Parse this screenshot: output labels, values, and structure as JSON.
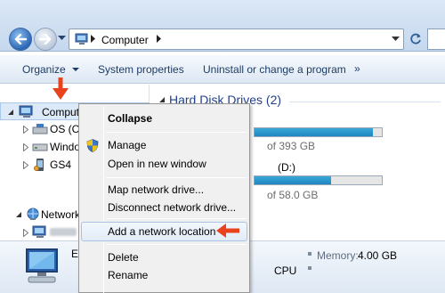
{
  "address": {
    "location": "Computer"
  },
  "commands": {
    "organize": "Organize",
    "system_properties": "System properties",
    "uninstall": "Uninstall or change a program",
    "more": "»"
  },
  "tree": {
    "computer": "Computer",
    "os": "OS (C:",
    "windows": "Windo",
    "gs4": "GS4",
    "network": "Network"
  },
  "main": {
    "group_title": "Hard Disk Drives (2)",
    "drive1_detail": "of 393 GB",
    "drive1_fill_percent": 93,
    "drive2_name": "(D:)",
    "drive2_detail": "of 58.0 GB",
    "drive2_fill_percent": 60
  },
  "details": {
    "name": "E",
    "memory_label": "Memory:",
    "memory_value": "4.00 GB",
    "cpu": "CPU"
  },
  "context_menu": {
    "items": [
      {
        "label": "Collapse"
      },
      {
        "label": "Manage"
      },
      {
        "label": "Open in new window"
      },
      {
        "label": "Map network drive..."
      },
      {
        "label": "Disconnect network drive..."
      },
      {
        "label": "Add a network location"
      },
      {
        "label": "Delete"
      },
      {
        "label": "Rename"
      }
    ]
  },
  "colors": {
    "annotation_arrow": "#e8431d",
    "accent": "#1f3f8f",
    "usage_bar": "#2797cf"
  }
}
